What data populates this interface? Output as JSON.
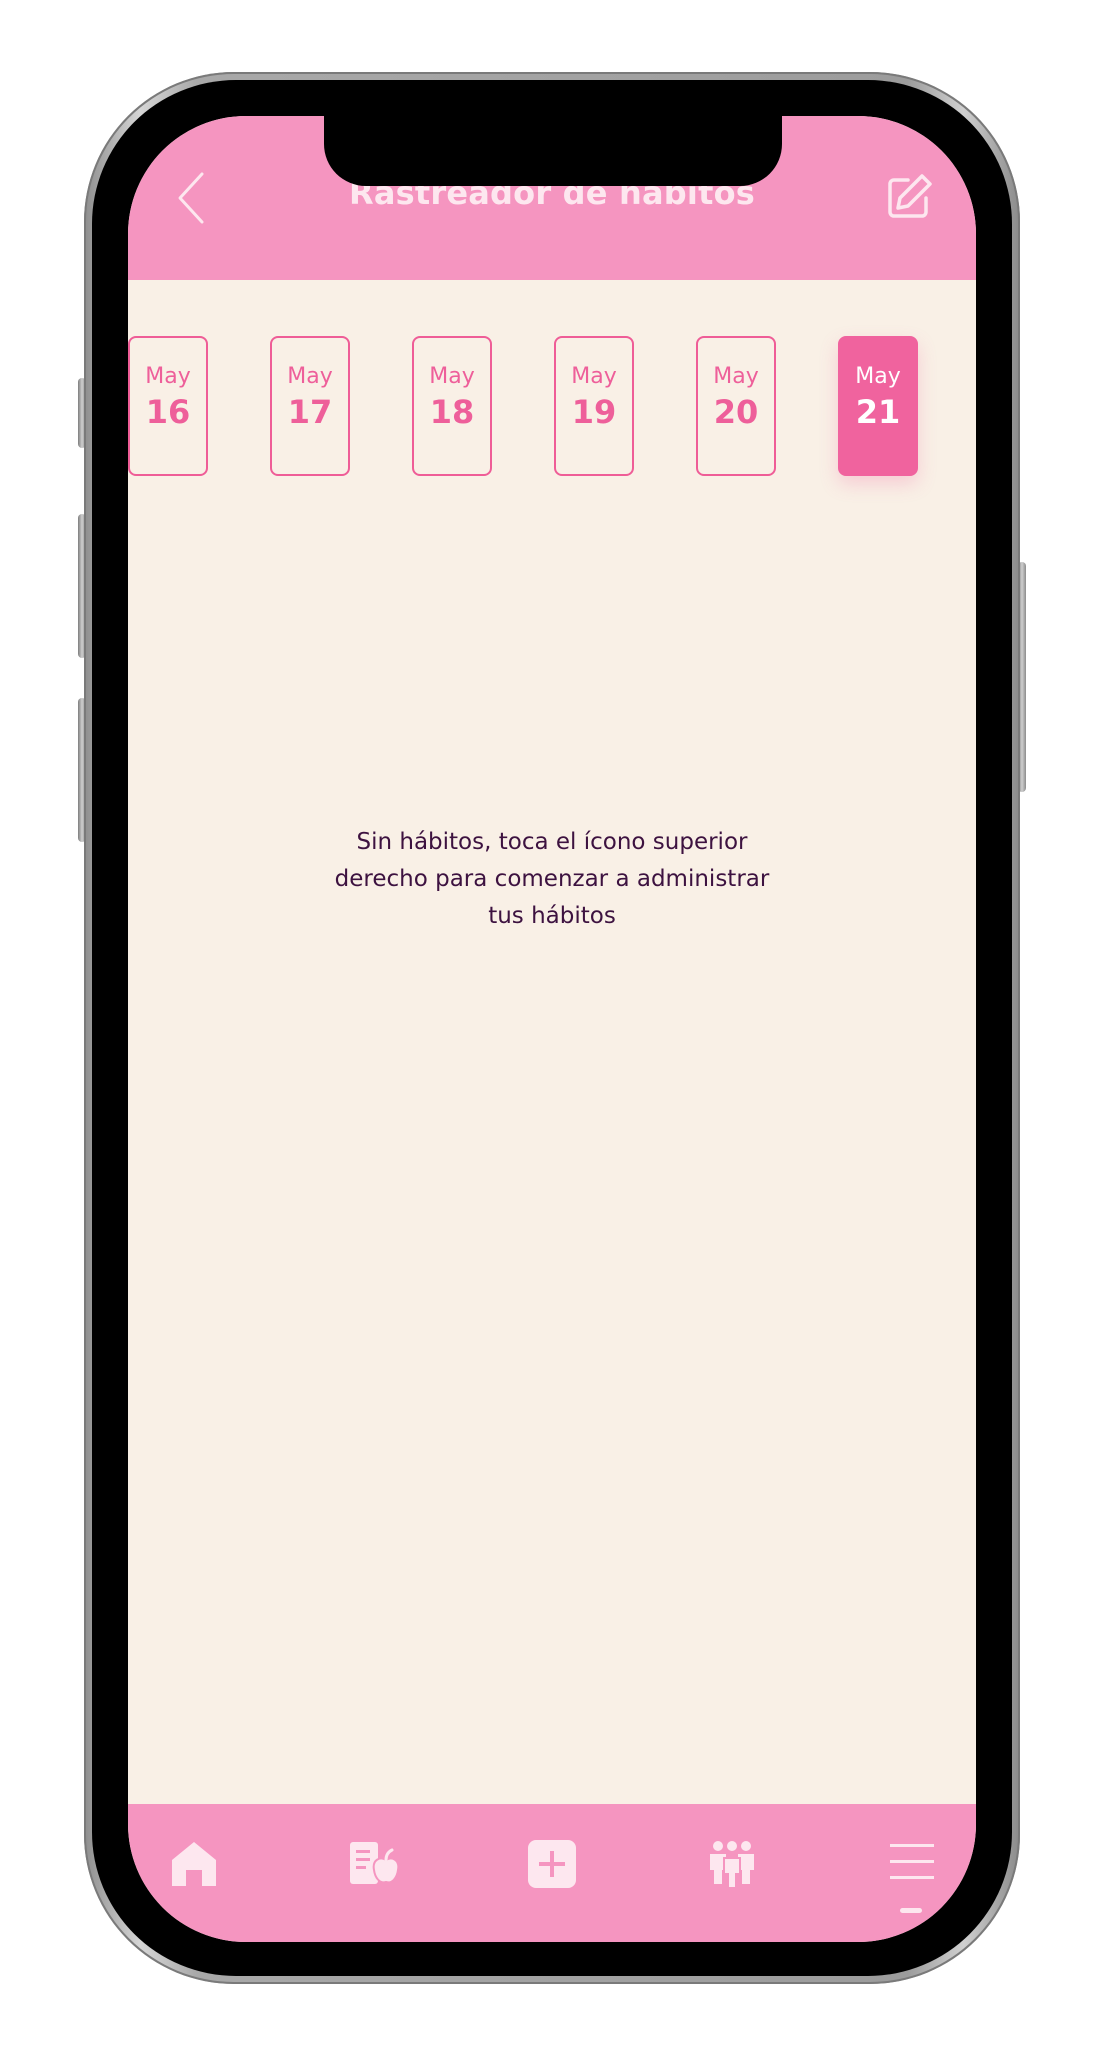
{
  "header": {
    "title": "Rastreador de hábitos",
    "back_icon": "chevron-left-icon",
    "edit_icon": "edit-icon"
  },
  "dates": [
    {
      "month": "May",
      "day": "16",
      "selected": false
    },
    {
      "month": "May",
      "day": "17",
      "selected": false
    },
    {
      "month": "May",
      "day": "18",
      "selected": false
    },
    {
      "month": "May",
      "day": "19",
      "selected": false
    },
    {
      "month": "May",
      "day": "20",
      "selected": false
    },
    {
      "month": "May",
      "day": "21",
      "selected": true
    }
  ],
  "empty_state": {
    "line1": "Sin hábitos, toca el ícono superior",
    "line2": "derecho para comenzar a administrar",
    "line3": "tus hábitos"
  },
  "bottom_nav": {
    "items": [
      "home-icon",
      "nutrition-list-icon",
      "add-icon",
      "community-icon",
      "menu-icon"
    ]
  },
  "colors": {
    "header_bg": "#f595c0",
    "accent": "#f0639e",
    "background": "#f9f0e6",
    "text_dark": "#3d1240",
    "icon_light": "#fde7ef"
  }
}
